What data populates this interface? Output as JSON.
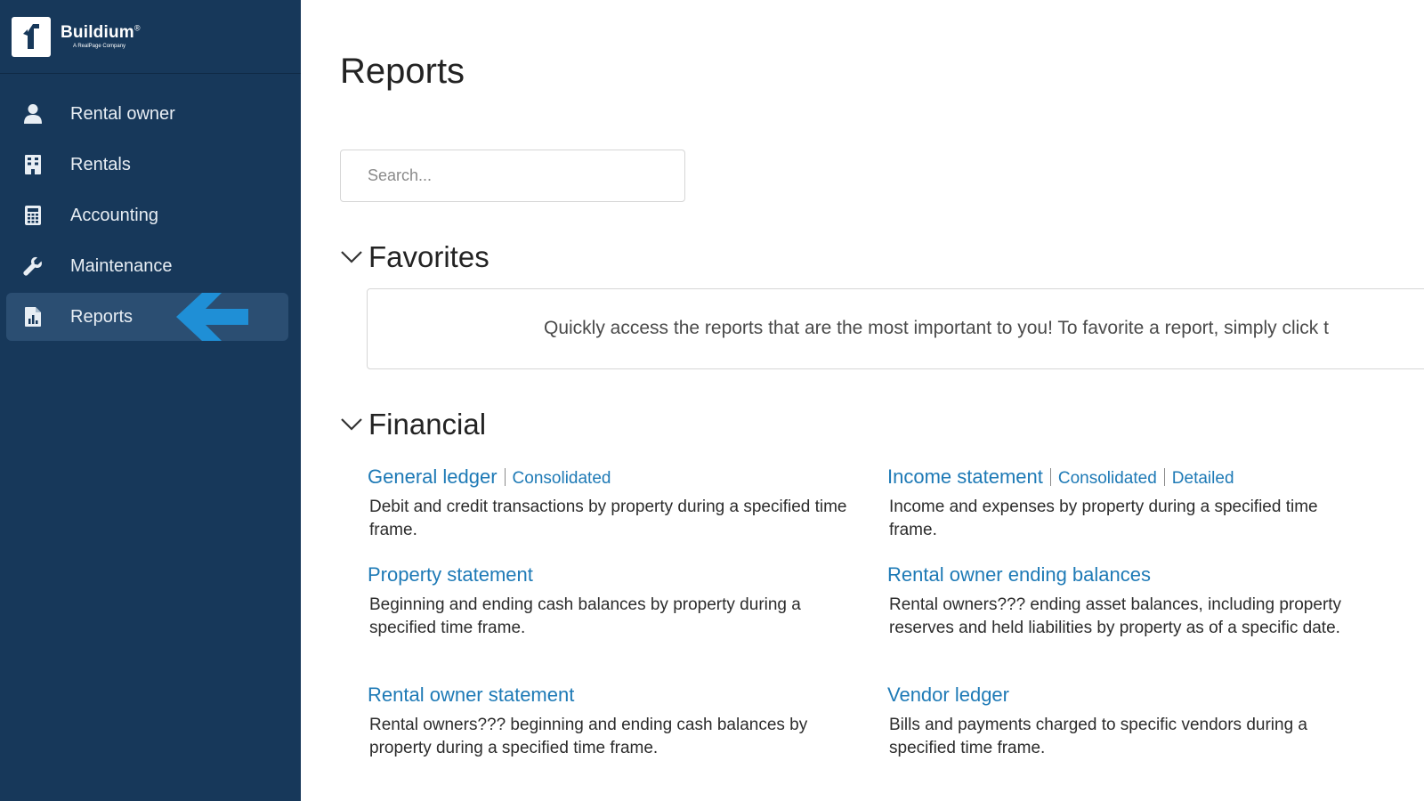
{
  "brand": {
    "name": "Buildium",
    "registered": "®",
    "tagline": "A RealPage Company"
  },
  "sidebar": {
    "items": [
      {
        "label": "Rental owner",
        "icon": "person-icon",
        "active": false
      },
      {
        "label": "Rentals",
        "icon": "building-icon",
        "active": false
      },
      {
        "label": "Accounting",
        "icon": "calculator-icon",
        "active": false
      },
      {
        "label": "Maintenance",
        "icon": "wrench-icon",
        "active": false
      },
      {
        "label": "Reports",
        "icon": "report-chart-icon",
        "active": true
      }
    ],
    "highlight_arrow": "left-arrow-icon"
  },
  "main": {
    "title": "Reports",
    "search": {
      "placeholder": "Search...",
      "value": ""
    },
    "favorites": {
      "title": "Favorites",
      "message": "Quickly access the reports that are the most important to you! To favorite a report, simply click t"
    },
    "financial": {
      "title": "Financial",
      "reports": [
        {
          "title": "General ledger",
          "links": [
            "Consolidated"
          ],
          "description": "Debit and credit transactions by property during a specified time frame."
        },
        {
          "title": "Income statement",
          "links": [
            "Consolidated",
            "Detailed"
          ],
          "description": "Income and expenses by property during a specified time frame."
        },
        {
          "title": "Property statement",
          "links": [],
          "description": "Beginning and ending cash balances by property during a specified time frame."
        },
        {
          "title": "Rental owner ending balances",
          "links": [],
          "description": "Rental owners??? ending asset balances, including property reserves and held liabilities by property as of a specific date."
        },
        {
          "title": "Rental owner statement",
          "links": [],
          "description": "Rental owners??? beginning and ending cash balances by property during a specified time frame."
        },
        {
          "title": "Vendor ledger",
          "links": [],
          "description": "Bills and payments charged to specific vendors during a specified time frame."
        }
      ]
    }
  },
  "colors": {
    "sidebar_bg": "#17385a",
    "active_bg": "#2b4e72",
    "link": "#1e7ab6",
    "arrow": "#1f8fd6"
  }
}
